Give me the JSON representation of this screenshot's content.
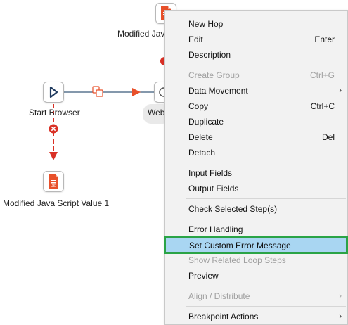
{
  "canvas": {
    "start_browser_label": "Start Browser",
    "js_bottom_label": "Modified Java Script Value 1",
    "js_top_label": "Modified Jav",
    "web_label": "Web",
    "js_file_tag": "JS"
  },
  "menu": {
    "items": [
      {
        "label": "New Hop",
        "accel": ""
      },
      {
        "label": "Edit",
        "accel": "Enter"
      },
      {
        "label": "Description",
        "accel": ""
      },
      {
        "label": "Create Group",
        "accel": "Ctrl+G"
      },
      {
        "label": "Data Movement",
        "accel": ""
      },
      {
        "label": "Copy",
        "accel": "Ctrl+C"
      },
      {
        "label": "Duplicate",
        "accel": ""
      },
      {
        "label": "Delete",
        "accel": "Del"
      },
      {
        "label": "Detach",
        "accel": ""
      },
      {
        "label": "Input Fields",
        "accel": ""
      },
      {
        "label": "Output Fields",
        "accel": ""
      },
      {
        "label": "Check Selected Step(s)",
        "accel": ""
      },
      {
        "label": "Error Handling",
        "accel": ""
      },
      {
        "label": "Set Custom Error Message",
        "accel": ""
      },
      {
        "label": "Show Related Loop Steps",
        "accel": ""
      },
      {
        "label": "Preview",
        "accel": ""
      },
      {
        "label": "Align / Distribute",
        "accel": ""
      },
      {
        "label": "Breakpoint Actions",
        "accel": ""
      }
    ],
    "submenu_arrow": "›"
  },
  "colors": {
    "accent_orange": "#e8502a",
    "error_red": "#d93025",
    "selection_bg": "#a9d6f2",
    "selection_outline": "#28a745",
    "hop_line": "#3a5a7a"
  }
}
